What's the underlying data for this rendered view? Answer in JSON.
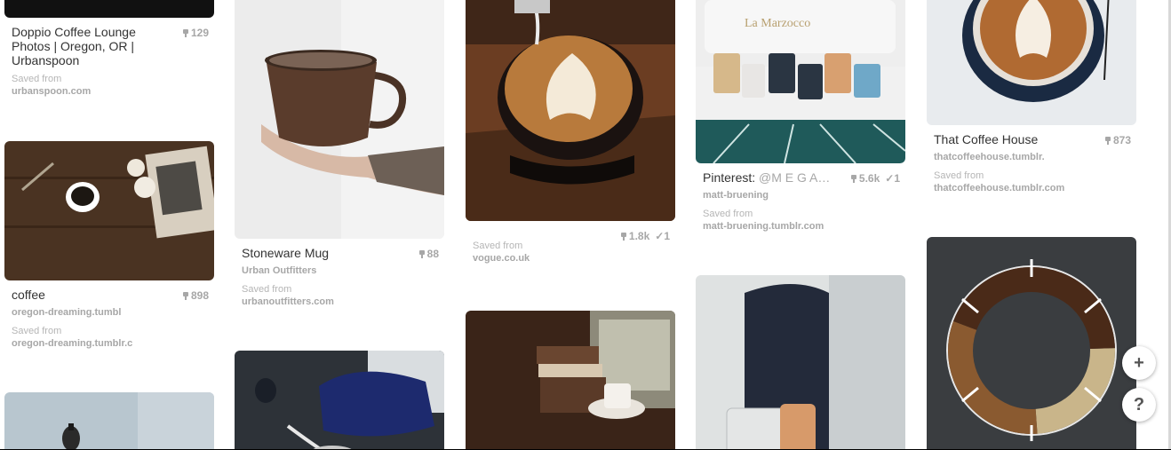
{
  "pins": [
    {
      "title": "Doppio Coffee Lounge Photos | Oregon, OR | Urbanspoon",
      "count": "129",
      "saved_label": "Saved from",
      "saved_site": "urbanspoon.com"
    },
    {
      "title": "coffee",
      "count": "898",
      "board": "oregon-dreaming.tumbl",
      "saved_label": "Saved from",
      "saved_site": "oregon-dreaming.tumblr.c"
    },
    {
      "title": "Stoneware Mug",
      "count": "88",
      "board": "Urban Outfitters",
      "saved_label": "Saved from",
      "saved_site": "urbanoutfitters.com"
    },
    {
      "count": "1.8k",
      "likes": "1",
      "saved_label": "Saved from",
      "saved_site": "vogue.co.uk"
    },
    {
      "title": "Pinterest:",
      "title_extra": "@M E G A…",
      "count": "5.6k",
      "likes": "1",
      "board": "matt-bruening",
      "saved_label": "Saved from",
      "saved_site": "matt-bruening.tumblr.com"
    },
    {
      "title": "That Coffee House",
      "count": "873",
      "board": "thatcoffeehouse.tumblr.",
      "saved_label": "Saved from",
      "saved_site": "thatcoffeehouse.tumblr.com"
    }
  ],
  "cup_text": {
    "brand": "La Marzocco"
  },
  "actions": {
    "add": "+",
    "help": "?"
  }
}
